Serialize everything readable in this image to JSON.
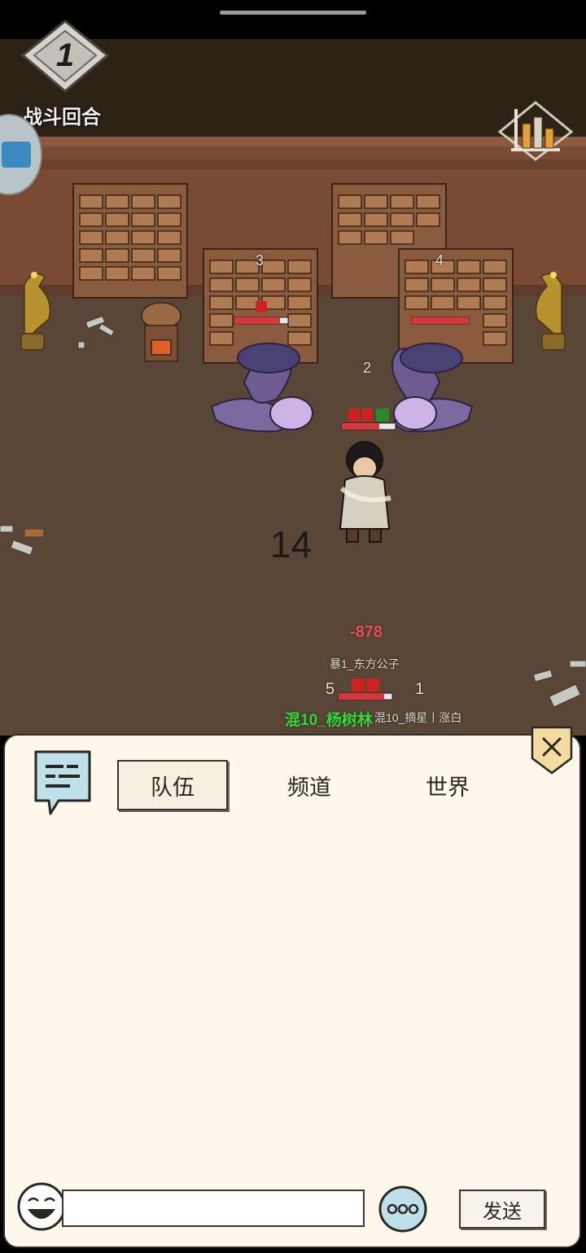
{
  "hud": {
    "round_number": "1",
    "round_label": "战斗回合"
  },
  "battle": {
    "enemy_left_index": "3",
    "enemy_right_index": "4",
    "player_index": "2",
    "turn_countdown": "14",
    "damage_number": "-878",
    "ally1_name": "暴1_东方公子",
    "ally1_left_index": "5",
    "ally1_right_index": "1",
    "ally2_name": "混10_杨树林",
    "ally3_name": "混10_摘星丨涨白"
  },
  "chat": {
    "tabs": [
      "队伍",
      "频道",
      "世界"
    ],
    "active_tab": "队伍",
    "input_value": "",
    "input_placeholder": "",
    "send_label": "发送"
  },
  "colors": {
    "wall": "#7a4b34",
    "floor": "#5a4636",
    "panel_bg": "#fdf7ec",
    "damage_red": "#e0545a",
    "ally_green": "#3fd13f"
  },
  "icons": [
    "round-diamond-icon",
    "stats-chart-icon",
    "chat-bubble-icon",
    "close-icon",
    "emoji-face-icon",
    "more-options-icon"
  ]
}
